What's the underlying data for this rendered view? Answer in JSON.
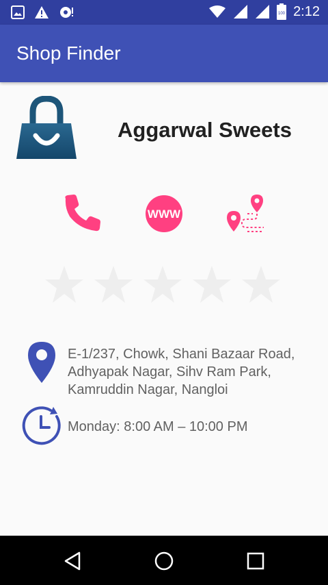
{
  "app": {
    "title": "Shop Finder",
    "status_time": "2:12",
    "battery_level": "100"
  },
  "shop": {
    "name": "Aggarwal Sweets",
    "rating": 0,
    "rating_max": 5,
    "address": "E-1/237, Chowk, Shani Bazaar Road, Adhyapak Nagar, Sihv Ram Park, Kamruddin Nagar, Nangloi",
    "hours": "Monday: 8:00 AM – 10:00 PM",
    "actions": {
      "call_icon": "phone-icon",
      "website_text": "WWW",
      "directions_icon": "route-icon"
    }
  },
  "colors": {
    "status_bar": "#303f9f",
    "app_bar": "#3f51b5",
    "action_pink": "#ff4081",
    "info_blue": "#3f51b5",
    "star_empty": "#eeeeee"
  }
}
